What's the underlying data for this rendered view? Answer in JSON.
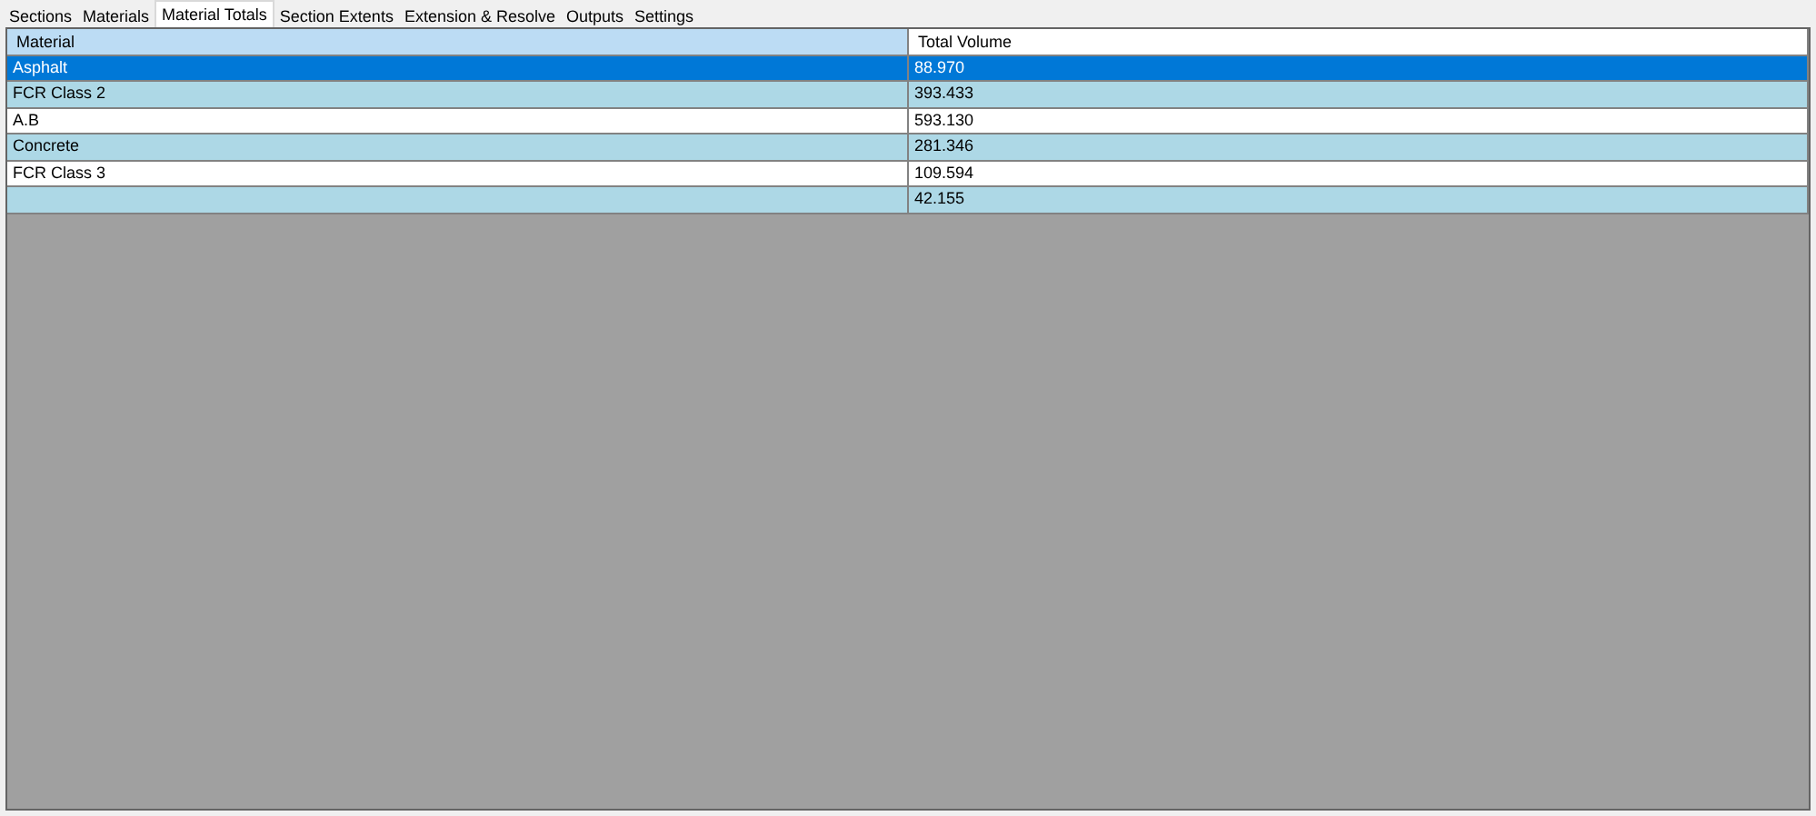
{
  "tabs": [
    {
      "label": "Sections",
      "selected": false
    },
    {
      "label": "Materials",
      "selected": false
    },
    {
      "label": "Material Totals",
      "selected": true
    },
    {
      "label": "Section Extents",
      "selected": false
    },
    {
      "label": "Extension & Resolve",
      "selected": false
    },
    {
      "label": "Outputs",
      "selected": false
    },
    {
      "label": "Settings",
      "selected": false
    }
  ],
  "table": {
    "columns": [
      {
        "label": "Material",
        "selected": true
      },
      {
        "label": "Total Volume",
        "selected": false
      }
    ],
    "rows": [
      {
        "cells": [
          "Asphalt",
          "88.970"
        ],
        "selected": true
      },
      {
        "cells": [
          "FCR Class 2",
          "393.433"
        ],
        "selected": false
      },
      {
        "cells": [
          "A.B",
          "593.130"
        ],
        "selected": false
      },
      {
        "cells": [
          "Concrete",
          "281.346"
        ],
        "selected": false
      },
      {
        "cells": [
          "FCR Class 3",
          "109.594"
        ],
        "selected": false
      },
      {
        "cells": [
          "",
          "42.155"
        ],
        "selected": false
      }
    ]
  }
}
